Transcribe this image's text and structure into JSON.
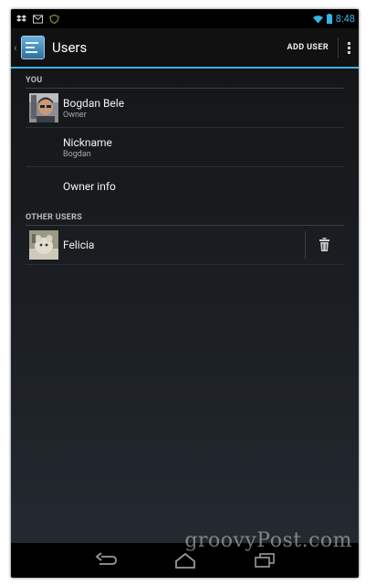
{
  "status_bar": {
    "notification_icons": [
      "dropbox-icon",
      "gmail-icon",
      "shield-icon"
    ],
    "system_icons": [
      "wifi-icon",
      "battery-icon"
    ],
    "time": "8:48"
  },
  "action_bar": {
    "title": "Users",
    "action_label": "ADD USER",
    "overflow_icon": "overflow-menu-icon"
  },
  "sections": {
    "you_header": "YOU",
    "others_header": "OTHER USERS"
  },
  "you": {
    "owner": {
      "name": "Bogdan Bele",
      "role": "Owner"
    },
    "nickname": {
      "label": "Nickname",
      "value": "Bogdan"
    },
    "owner_info": {
      "label": "Owner info"
    }
  },
  "other_users": [
    {
      "name": "Felicia",
      "action_icon": "trash-icon"
    }
  ],
  "nav_bar": {
    "buttons": [
      "back-icon",
      "home-icon",
      "recents-icon"
    ]
  },
  "watermark": "groovyPost.com",
  "colors": {
    "accent": "#33b5e5",
    "background_top": "#141414",
    "background_bottom": "#252b31"
  }
}
